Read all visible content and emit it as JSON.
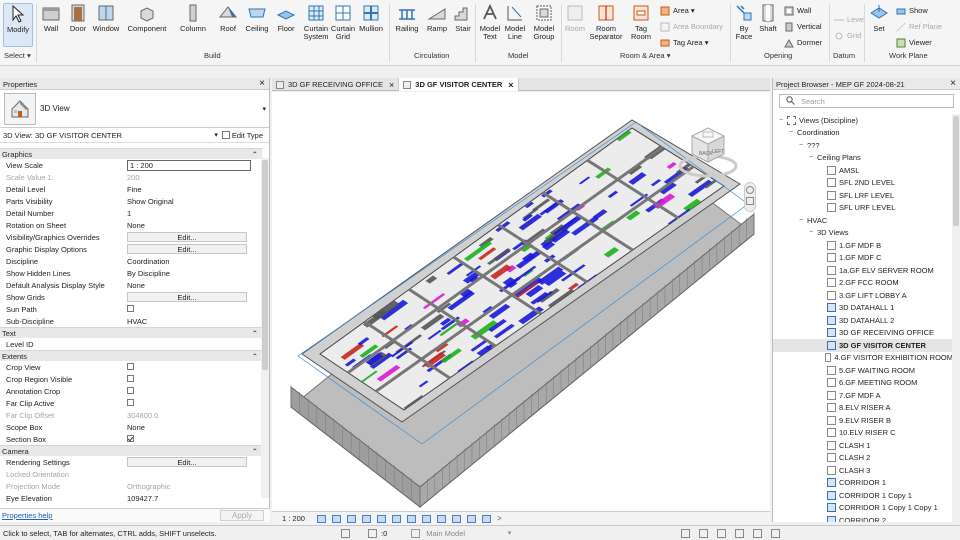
{
  "ribbon": {
    "select": {
      "label": "Modify",
      "group": "Select"
    },
    "build": {
      "group": "Build",
      "buttons": [
        "Wall",
        "Door",
        "Window",
        "Component",
        "Column",
        "Roof",
        "Ceiling",
        "Floor",
        "Curtain System",
        "Curtain Grid",
        "Mullion"
      ]
    },
    "circulation": {
      "group": "Circulation",
      "buttons": [
        "Railing",
        "Ramp",
        "Stair"
      ]
    },
    "model": {
      "group": "Model",
      "buttons": [
        "Model Text",
        "Model Line",
        "Model Group"
      ]
    },
    "room": {
      "group": "Room & Area",
      "buttons": [
        "Room",
        "Room Separator",
        "Tag Room"
      ],
      "small": [
        "Area",
        "Area Boundary",
        "Tag Area"
      ]
    },
    "opening": {
      "group": "Opening",
      "buttons": [
        "By Face",
        "Shaft"
      ],
      "small": [
        "Wall",
        "Vertical",
        "Dormer"
      ]
    },
    "datum": {
      "group": "Datum",
      "small": [
        "Level",
        "Grid"
      ]
    },
    "workplane": {
      "group": "Work Plane",
      "buttons": [
        "Set"
      ],
      "small": [
        "Show",
        "Ref Plane",
        "Viewer"
      ]
    }
  },
  "properties": {
    "title": "Properties",
    "type_name": "3D View",
    "instance": "3D View: 3D GF VISITOR CENTER",
    "edit_type": "Edit Type",
    "help": "Properties help",
    "apply": "Apply",
    "sections": [
      {
        "name": "Graphics",
        "rows": [
          {
            "n": "View Scale",
            "v": "1 : 200",
            "k": "box"
          },
          {
            "n": "Scale Value    1:",
            "v": "200",
            "k": "dis"
          },
          {
            "n": "Detail Level",
            "v": "Fine"
          },
          {
            "n": "Parts Visibility",
            "v": "Show Original"
          },
          {
            "n": "Detail Number",
            "v": "1"
          },
          {
            "n": "Rotation on Sheet",
            "v": "None"
          },
          {
            "n": "Visibility/Graphics Overrides",
            "v": "Edit...",
            "k": "btn"
          },
          {
            "n": "Graphic Display Options",
            "v": "Edit...",
            "k": "btn"
          },
          {
            "n": "Discipline",
            "v": "Coordination"
          },
          {
            "n": "Show Hidden Lines",
            "v": "By Discipline"
          },
          {
            "n": "Default Analysis Display Style",
            "v": "None"
          },
          {
            "n": "Show Grids",
            "v": "Edit...",
            "k": "btn"
          },
          {
            "n": "Sun Path",
            "v": "",
            "k": "chk"
          },
          {
            "n": "Sub-Discipline",
            "v": "HVAC"
          }
        ]
      },
      {
        "name": "Text",
        "rows": [
          {
            "n": "Level ID",
            "v": ""
          }
        ]
      },
      {
        "name": "Extents",
        "rows": [
          {
            "n": "Crop View",
            "v": "",
            "k": "chk"
          },
          {
            "n": "Crop Region Visible",
            "v": "",
            "k": "chk"
          },
          {
            "n": "Annotation Crop",
            "v": "",
            "k": "chk"
          },
          {
            "n": "Far Clip Active",
            "v": "",
            "k": "chk"
          },
          {
            "n": "Far Clip Offset",
            "v": "304800.0",
            "k": "dis"
          },
          {
            "n": "Scope Box",
            "v": "None"
          },
          {
            "n": "Section Box",
            "v": "",
            "k": "chkon"
          }
        ]
      },
      {
        "name": "Camera",
        "rows": [
          {
            "n": "Rendering Settings",
            "v": "Edit...",
            "k": "btn"
          },
          {
            "n": "Locked Orientation",
            "v": "",
            "k": "dis"
          },
          {
            "n": "Projection Mode",
            "v": "Orthographic",
            "k": "dis"
          },
          {
            "n": "Eye Elevation",
            "v": "109427.7"
          }
        ]
      }
    ]
  },
  "tabs": [
    {
      "label": "3D GF RECEIVING OFFICE",
      "active": false
    },
    {
      "label": "3D GF VISITOR CENTER",
      "active": true
    }
  ],
  "viewbar": {
    "scale": "1 : 200"
  },
  "viewcube": {
    "faces": [
      "BACK",
      "LEFT"
    ]
  },
  "browser": {
    "title": "Project Browser - MEP GF 2024-08-21",
    "search_placeholder": "Search",
    "nodes": [
      {
        "l": "Views (Discipline)",
        "d": 0,
        "t": "-",
        "i": "root"
      },
      {
        "l": "Coordination",
        "d": 1,
        "t": "-"
      },
      {
        "l": "???",
        "d": 2,
        "t": "-"
      },
      {
        "l": "Ceiling Plans",
        "d": 3,
        "t": "-"
      },
      {
        "l": "AMSL",
        "d": 4,
        "i": "v"
      },
      {
        "l": "SFL 2ND LEVEL",
        "d": 4,
        "i": "v"
      },
      {
        "l": "SFL LRF LEVEL",
        "d": 4,
        "i": "v"
      },
      {
        "l": "SFL URF LEVEL",
        "d": 4,
        "i": "v"
      },
      {
        "l": "HVAC",
        "d": 2,
        "t": "-"
      },
      {
        "l": "3D Views",
        "d": 3,
        "t": "-"
      },
      {
        "l": "1.GF MDF B",
        "d": 4,
        "i": "v"
      },
      {
        "l": "1.GF MDF C",
        "d": 4,
        "i": "v"
      },
      {
        "l": "1a.GF ELV SERVER ROOM",
        "d": 4,
        "i": "v"
      },
      {
        "l": "2.GF FCC ROOM",
        "d": 4,
        "i": "v"
      },
      {
        "l": "3.GF LIFT LOBBY A",
        "d": 4,
        "i": "v"
      },
      {
        "l": "3D DATAHALL 1",
        "d": 4,
        "i": "3d"
      },
      {
        "l": "3D DATAHALL 2",
        "d": 4,
        "i": "3d"
      },
      {
        "l": "3D GF RECEIVING OFFICE",
        "d": 4,
        "i": "3d"
      },
      {
        "l": "3D GF VISITOR CENTER",
        "d": 4,
        "i": "3d",
        "sel": true
      },
      {
        "l": "4.GF VISITOR EXHIBITION ROOM",
        "d": 4,
        "i": "v"
      },
      {
        "l": "5.GF WAITING ROOM",
        "d": 4,
        "i": "v"
      },
      {
        "l": "6.GF MEETING ROOM",
        "d": 4,
        "i": "v"
      },
      {
        "l": "7.GF MDF A",
        "d": 4,
        "i": "v"
      },
      {
        "l": "8.ELV RISER A",
        "d": 4,
        "i": "v"
      },
      {
        "l": "9.ELV RISER B",
        "d": 4,
        "i": "v"
      },
      {
        "l": "10.ELV RISER C",
        "d": 4,
        "i": "v"
      },
      {
        "l": "CLASH 1",
        "d": 4,
        "i": "v"
      },
      {
        "l": "CLASH 2",
        "d": 4,
        "i": "v"
      },
      {
        "l": "CLASH 3",
        "d": 4,
        "i": "v"
      },
      {
        "l": "CORRIDOR 1",
        "d": 4,
        "i": "3d"
      },
      {
        "l": "CORRIDOR 1 Copy 1",
        "d": 4,
        "i": "3d"
      },
      {
        "l": "CORRIDOR 1 Copy 1 Copy 1",
        "d": 4,
        "i": "3d"
      },
      {
        "l": "CORRIDOR 2",
        "d": 4,
        "i": "3d"
      }
    ]
  },
  "status": {
    "message": "Click to select, TAB for alternates, CTRL adds, SHIFT unselects.",
    "zero": ":0",
    "model": "Main Model"
  },
  "colors": {
    "accent": "#1d5fbf",
    "duct_blue": "#1a1ad8",
    "pipe_green": "#1db21d",
    "pipe_magenta": "#d81ad8",
    "pipe_red": "#c8281e"
  }
}
